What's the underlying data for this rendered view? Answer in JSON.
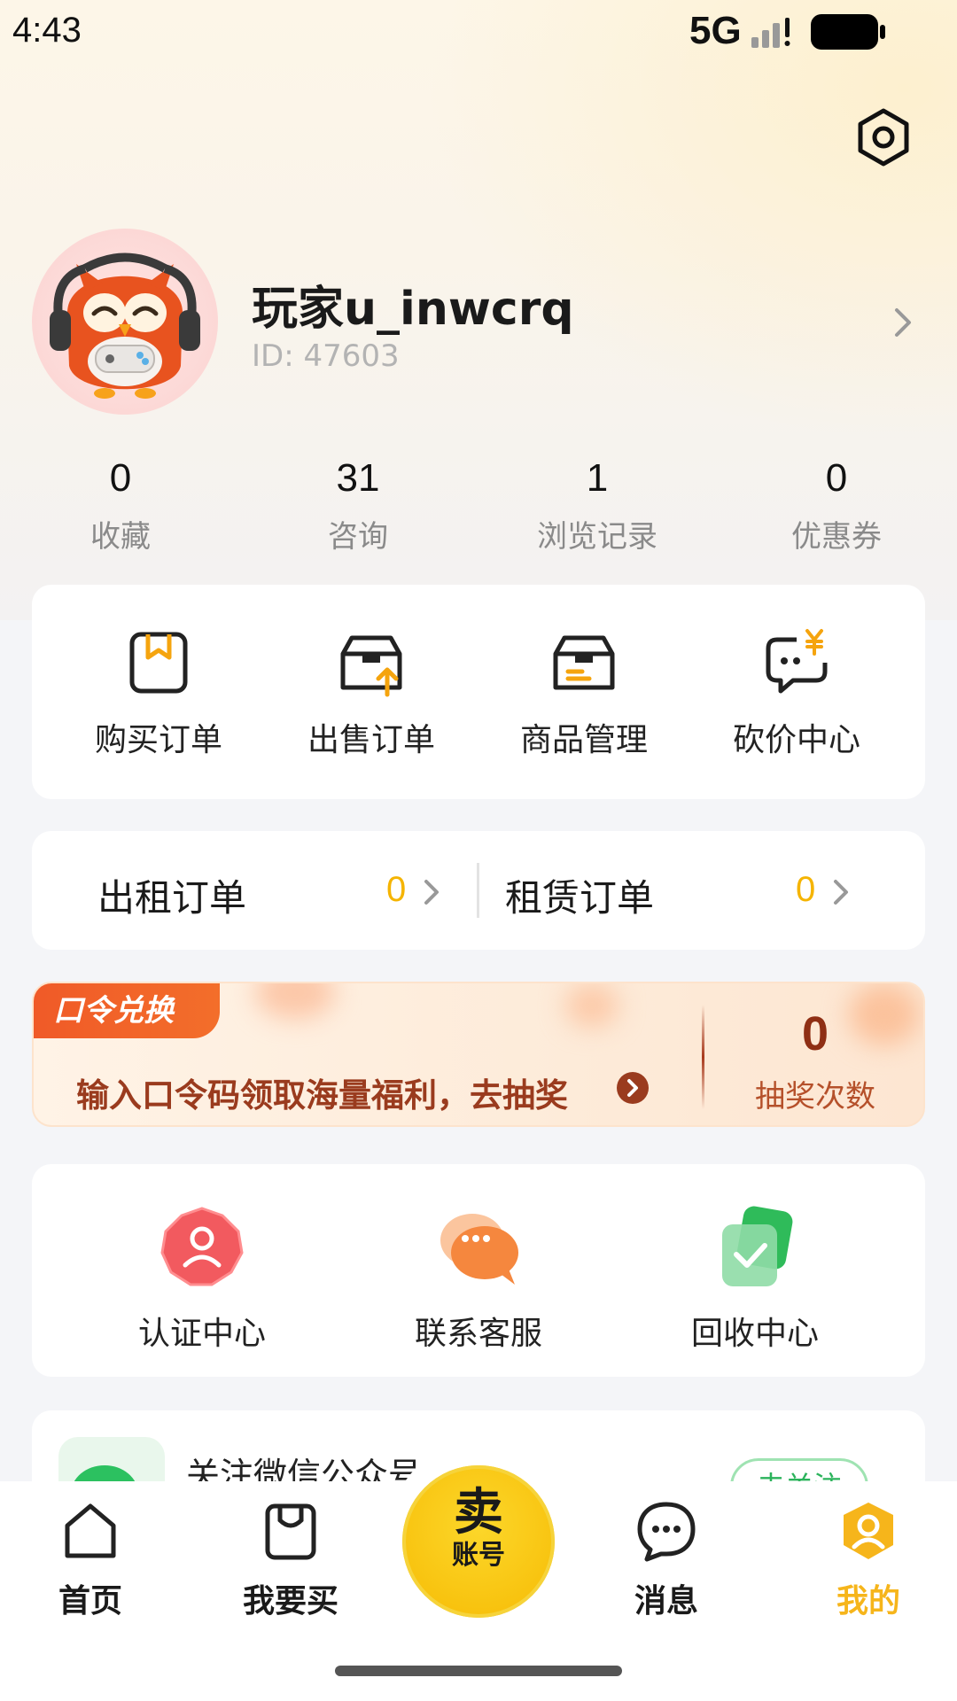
{
  "status_bar": {
    "time": "4:43",
    "network": "5G"
  },
  "profile": {
    "username": "玩家u_inwcrq",
    "id_text": "ID: 47603"
  },
  "stats": [
    {
      "value": "0",
      "label": "收藏"
    },
    {
      "value": "31",
      "label": "咨询"
    },
    {
      "value": "1",
      "label": "浏览记录"
    },
    {
      "value": "0",
      "label": "优惠券"
    }
  ],
  "orders": [
    {
      "label": "购买订单",
      "icon": "purchase-order-icon"
    },
    {
      "label": "出售订单",
      "icon": "sale-order-icon"
    },
    {
      "label": "商品管理",
      "icon": "product-manage-icon"
    },
    {
      "label": "砍价中心",
      "icon": "bargain-center-icon"
    }
  ],
  "rent": {
    "out": {
      "label": "出租订单",
      "count": "0"
    },
    "in": {
      "label": "租赁订单",
      "count": "0"
    }
  },
  "promo": {
    "tag": "口令兑换",
    "text": "输入口令码领取海量福利，去抽奖",
    "count": "0",
    "count_label": "抽奖次数"
  },
  "services": [
    {
      "label": "认证中心",
      "icon": "verify-center-icon"
    },
    {
      "label": "联系客服",
      "icon": "customer-service-icon"
    },
    {
      "label": "回收中心",
      "icon": "recycle-center-icon"
    }
  ],
  "wechat": {
    "text": "关注微信公众号",
    "button": "去关注"
  },
  "tabbar": {
    "home": "首页",
    "buy": "我要买",
    "sell_big": "卖",
    "sell_small": "账号",
    "messages": "消息",
    "mine": "我的"
  },
  "colors": {
    "accent": "#f6b51b",
    "promo_tag": "#f05a28",
    "promo_text": "#9a3b1e"
  }
}
